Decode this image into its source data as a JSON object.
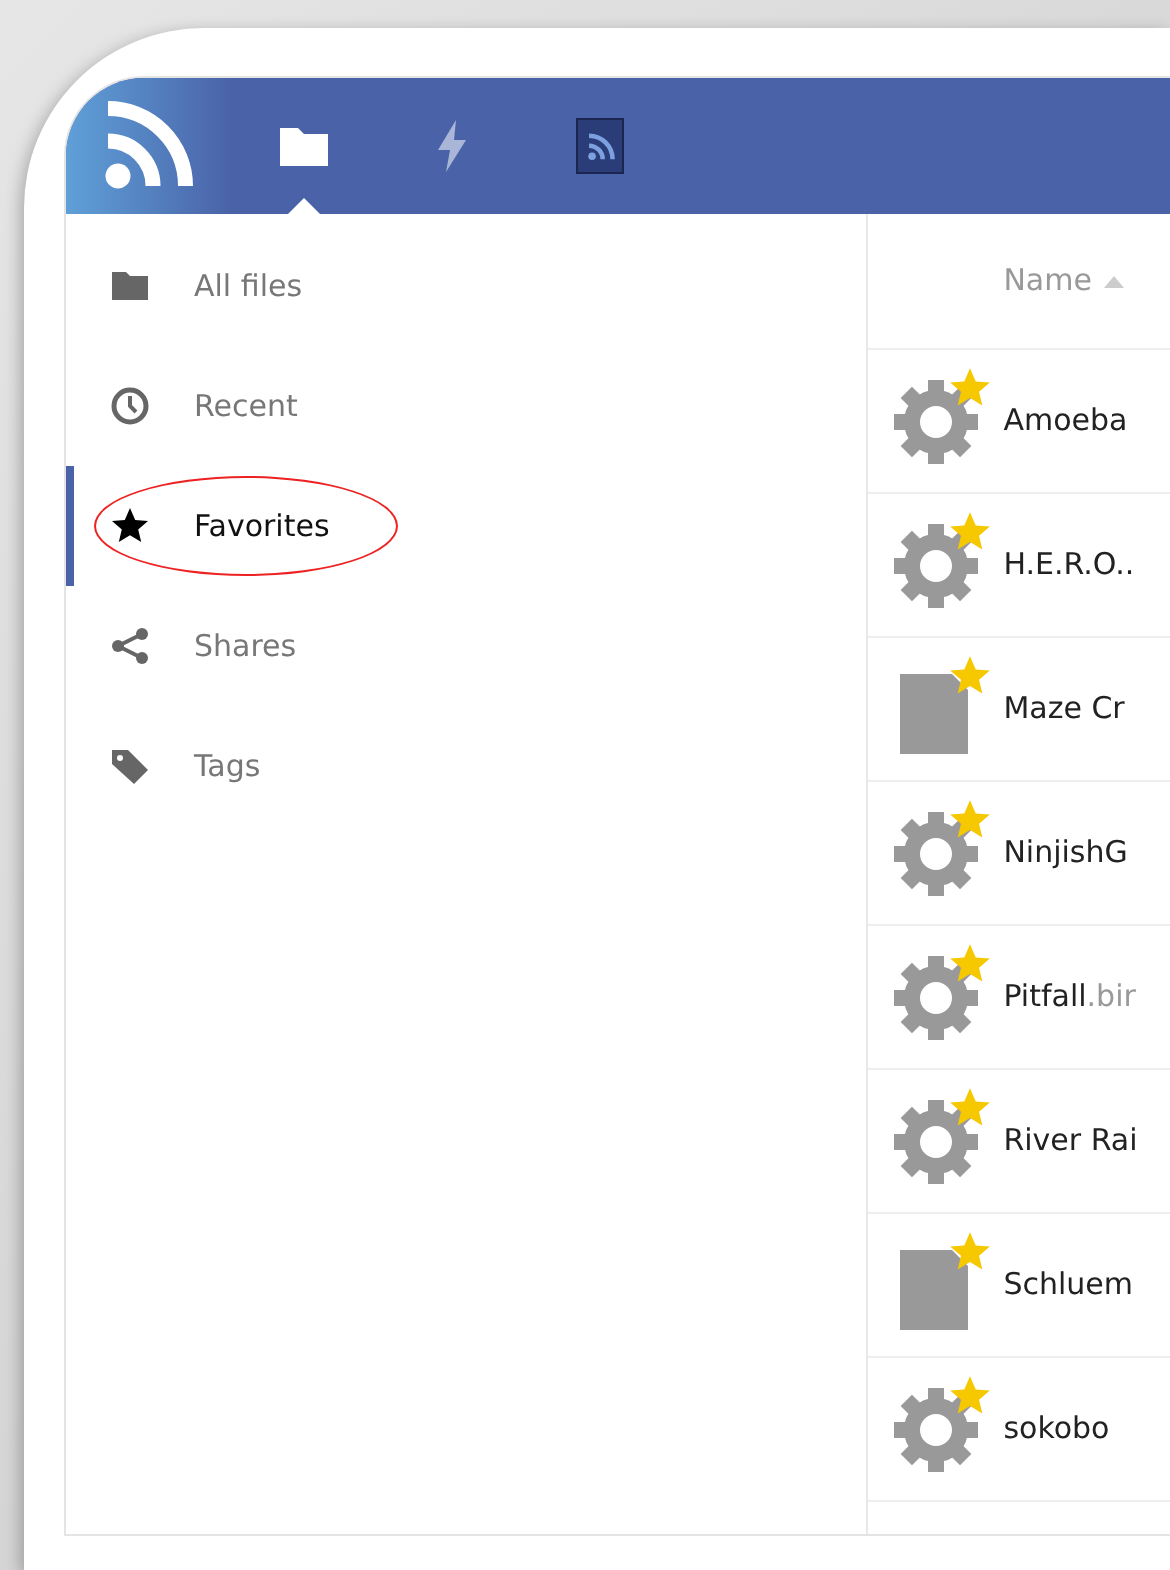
{
  "header": {
    "apps": [
      {
        "kind": "files",
        "selected": true
      },
      {
        "kind": "activity",
        "selected": false
      },
      {
        "kind": "news",
        "selected": false
      }
    ]
  },
  "sidebar": {
    "items": [
      {
        "kind": "folder",
        "label": "All files",
        "selected": false,
        "circled": false
      },
      {
        "kind": "clock",
        "label": "Recent",
        "selected": false,
        "circled": false
      },
      {
        "kind": "star",
        "label": "Favorites",
        "selected": true,
        "circled": true
      },
      {
        "kind": "share",
        "label": "Shares",
        "selected": false,
        "circled": false
      },
      {
        "kind": "tag",
        "label": "Tags",
        "selected": false,
        "circled": false
      }
    ]
  },
  "files": {
    "column": "Name",
    "sort_ascending": true,
    "rows": [
      {
        "kind": "gear",
        "name": "Amoeba",
        "favorite": true
      },
      {
        "kind": "gear",
        "name": "H.E.R.O..",
        "favorite": true
      },
      {
        "kind": "file",
        "name": "Maze Cr",
        "favorite": true
      },
      {
        "kind": "gear",
        "name": "NinjishG",
        "favorite": true
      },
      {
        "kind": "gear",
        "name": "Pitfall",
        "ext": ".bir",
        "favorite": true
      },
      {
        "kind": "gear",
        "name": "River Rai",
        "favorite": true
      },
      {
        "kind": "file",
        "name": "Schluem",
        "favorite": true
      },
      {
        "kind": "gear",
        "name": "sokobo",
        "favorite": true
      }
    ]
  }
}
